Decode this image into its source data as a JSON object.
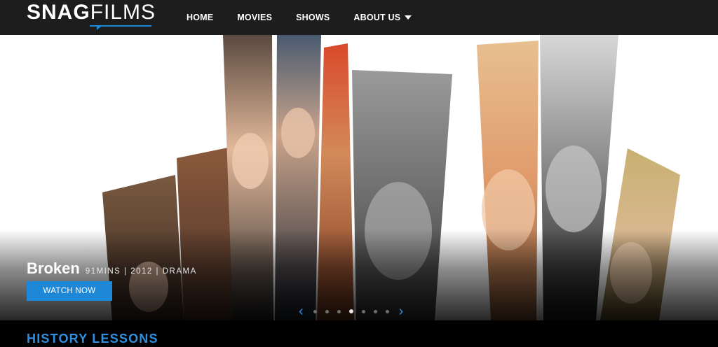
{
  "brand": {
    "name_bold": "SNAG",
    "name_light": "FILMS",
    "accent": "#1e88d8"
  },
  "nav": {
    "items": [
      {
        "label": "HOME"
      },
      {
        "label": "MOVIES"
      },
      {
        "label": "SHOWS"
      },
      {
        "label": "ABOUT US",
        "has_dropdown": true,
        "icon": "caret-down-icon"
      }
    ]
  },
  "hero": {
    "film": {
      "title": "Broken",
      "duration": "91MINS",
      "year": "2012",
      "genre": "DRAMA",
      "meta_separator": " | "
    },
    "watch_button_label": "WATCH NOW",
    "pager": {
      "prev_icon": "chevron-left-icon",
      "next_icon": "chevron-right-icon",
      "total": 7,
      "active_index": 3
    }
  },
  "section": {
    "title": "HISTORY LESSONS"
  }
}
